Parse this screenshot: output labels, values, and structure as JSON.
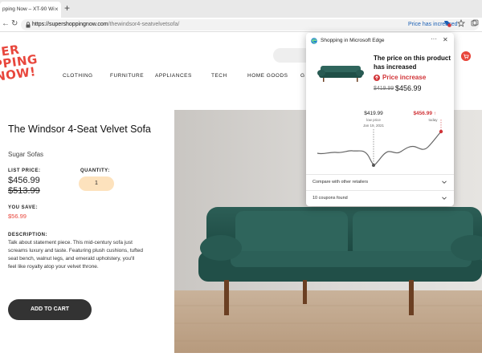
{
  "browser": {
    "tab_title": "pping Now – XT-90 Wi",
    "new_tab_symbol": "+",
    "tab_close_symbol": "×",
    "url_domain": "https://supershoppingnow.com",
    "url_path": "/thewindsor4-seatvelvetsofa/",
    "price_status": "Price has increased"
  },
  "store": {
    "logo_lines": [
      "PER",
      "PPING",
      "NOW!"
    ],
    "nav": [
      "CLOTHING",
      "FURNITURE",
      "APPLIANCES",
      "TECH",
      "HOME GOODS",
      "G"
    ]
  },
  "product": {
    "title": "The Windsor 4-Seat Velvet Sofa",
    "subtitle": "Sugar Sofas",
    "list_price_label": "LIST PRICE:",
    "price_current": "$456.99",
    "price_original": "$513.99",
    "quantity_label": "QUANTITY:",
    "quantity_value": "1",
    "you_save_label": "YOU SAVE:",
    "you_save_value": "$56.99",
    "description_label": "DESCRIPTION:",
    "description": "Talk about statement piece. This mid-century sofa just screams luxury and taste. Featuring plush cushions, tufted seat bench, walnut legs, and emerald upholstery, you'll feel like royalty atop your velvet throne.",
    "add_to_cart": "ADD TO CART"
  },
  "flyout": {
    "title": "Shopping in Microsoft Edge",
    "more_symbol": "···",
    "close_symbol": "✕",
    "headline": "The price on this product has increased",
    "badge": "Price increase",
    "old_price": "$419.99",
    "new_price": "$456.99",
    "low_price_value": "$419.99",
    "low_price_label": "low price",
    "low_price_date": "Jan 19, 2021",
    "today_value": "$456.99 ↑",
    "today_label": "today",
    "compare_label": "Compare with other retailers",
    "coupons_label": "10 coupons found"
  },
  "colors": {
    "brand_red": "#e8463c",
    "price_increase_red": "#d13438",
    "edge_blue": "#1a5fb4",
    "sofa_green": "#1f4f47"
  },
  "icons": [
    "lock-icon",
    "edge-logo-icon",
    "price-tag-icon",
    "star-icon",
    "collections-icon",
    "cart-icon",
    "search-icon",
    "chevron-down-icon"
  ]
}
